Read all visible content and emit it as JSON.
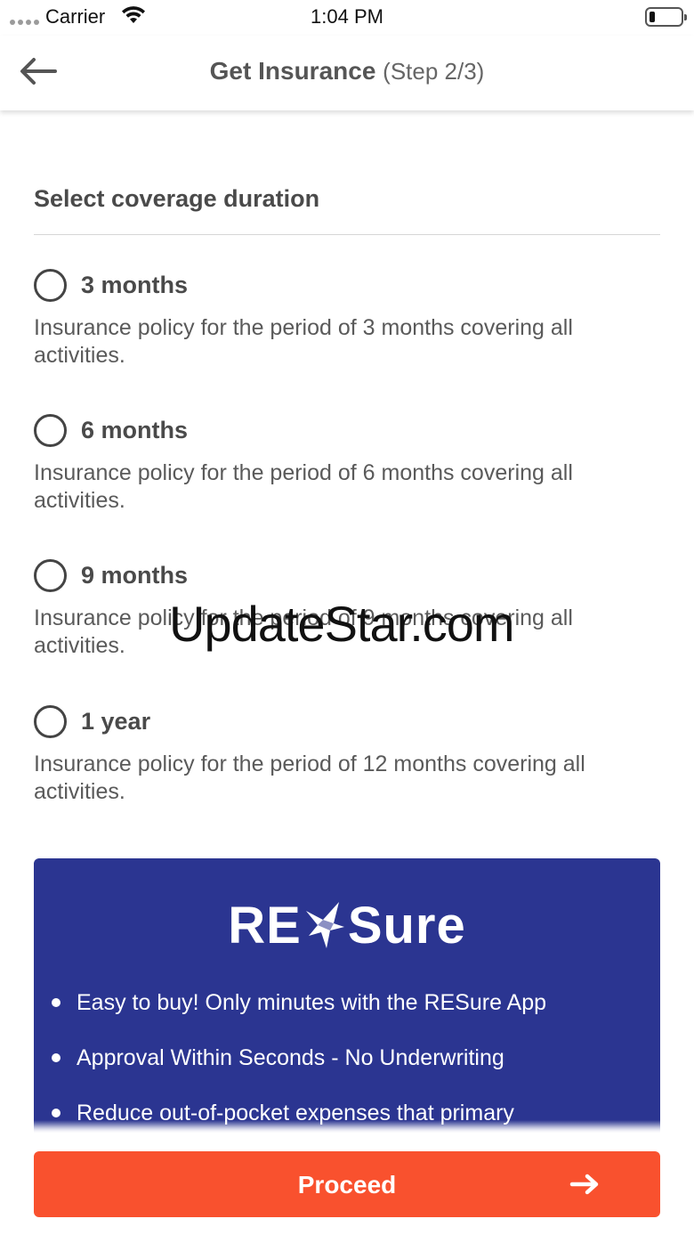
{
  "status_bar": {
    "carrier": "Carrier",
    "time": "1:04 PM"
  },
  "nav": {
    "title": "Get Insurance",
    "step": "(Step 2/3)",
    "back_icon": "arrow-left-icon"
  },
  "section": {
    "title": "Select coverage duration"
  },
  "options": [
    {
      "label": "3 months",
      "description": "Insurance policy for the period of 3 months covering all activities.",
      "selected": false
    },
    {
      "label": "6 months",
      "description": "Insurance policy for the period of 6 months covering all activities.",
      "selected": false
    },
    {
      "label": "9 months",
      "description": "Insurance policy for the period of 9 months covering all activities.",
      "selected": false
    },
    {
      "label": "1 year",
      "description": "Insurance policy for the period of 12 months covering all activities.",
      "selected": false
    }
  ],
  "promo": {
    "logo_text_left": "RE",
    "logo_text_right": "Sure",
    "bullets": [
      "Easy to buy! Only minutes with the RESure App",
      "Approval Within Seconds - No Underwriting",
      "Reduce out-of-pocket expenses that primary"
    ],
    "background_color": "#2b3591"
  },
  "proceed": {
    "label": "Proceed",
    "color": "#f9512e",
    "icon": "arrow-right-icon"
  },
  "watermark": "UpdateStar.com"
}
